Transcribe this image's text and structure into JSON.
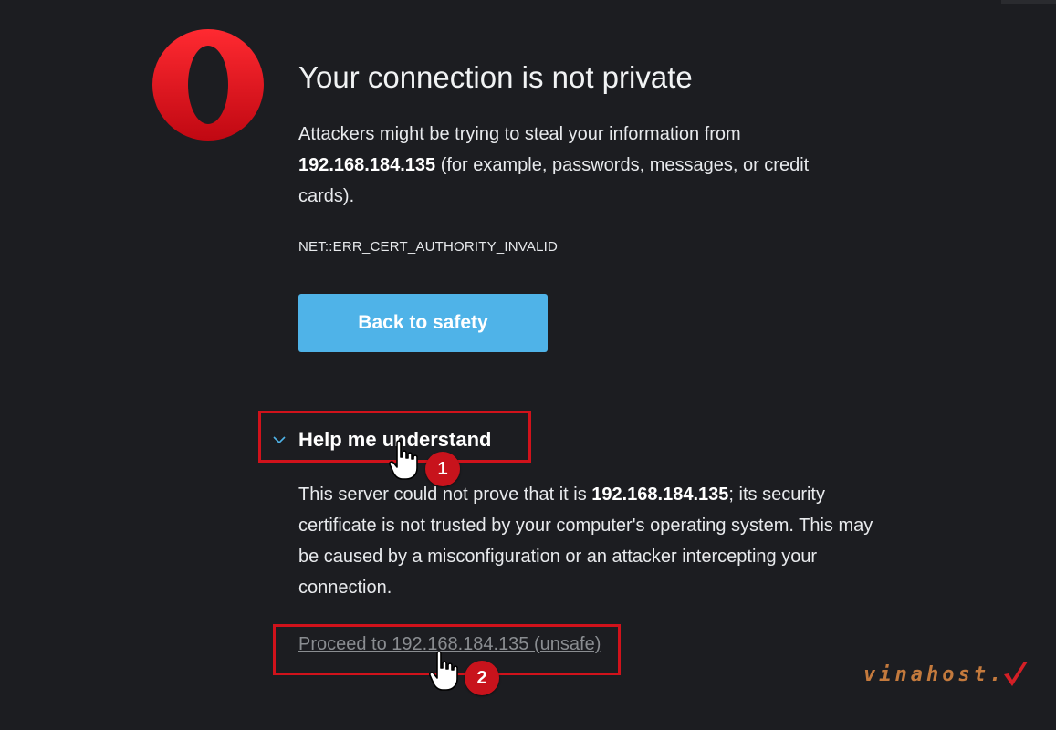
{
  "page": {
    "title": "Your connection is not private",
    "intro_part1": "Attackers might be trying to steal your information from ",
    "host": "192.168.184.135",
    "intro_part2": " (for example, passwords, messages, or credit cards).",
    "error_code": "NET::ERR_CERT_AUTHORITY_INVALID",
    "back_button_label": "Back to safety",
    "details_toggle_label": "Help me understand",
    "detail_part1": "This server could not prove that it is ",
    "detail_host": "192.168.184.135",
    "detail_part2": "; its security certificate is not trusted by your computer's operating system. This may be caused by a misconfiguration or an attacker intercepting your connection.",
    "proceed_link_label": "Proceed to 192.168.184.135 (unsafe)"
  },
  "annotations": {
    "step1_number": "1",
    "step2_number": "2",
    "highlight_color": "#d0121b",
    "badge_color": "#c8131c"
  },
  "watermark": {
    "text": "vinahost.",
    "color": "#c47a3d"
  },
  "icons": {
    "logo": "opera-logo-icon",
    "chevron": "chevron-down-icon",
    "cursor": "hand-pointer-icon",
    "watermark_mark": "checkmark-icon"
  },
  "colors": {
    "background": "#1c1d21",
    "primary_button": "#4fb3e8",
    "logo_red": "#e5161f",
    "link": "#8a8d91"
  }
}
